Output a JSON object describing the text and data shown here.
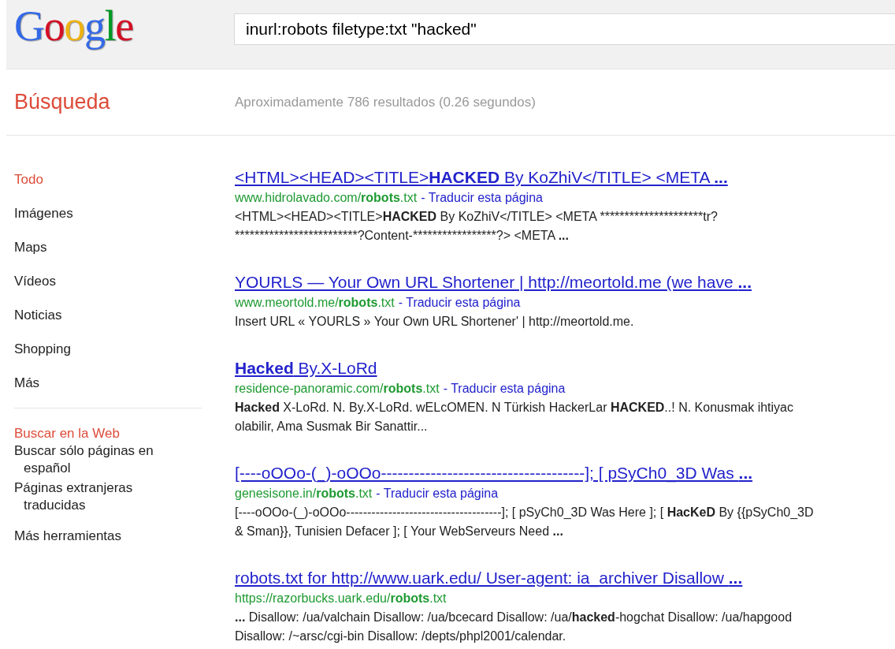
{
  "logo": "Google",
  "search": {
    "value": "inurl:robots filetype:txt \"hacked\""
  },
  "section_title": "Búsqueda",
  "result_stats": "Aproximadamente 786 resultados (0.26 segundos)",
  "sidebar": {
    "items": [
      {
        "label": "Todo",
        "selected": true
      },
      {
        "label": "Imágenes",
        "selected": false
      },
      {
        "label": "Maps",
        "selected": false
      },
      {
        "label": "Vídeos",
        "selected": false
      },
      {
        "label": "Noticias",
        "selected": false
      },
      {
        "label": "Shopping",
        "selected": false
      },
      {
        "label": "Más",
        "selected": false
      }
    ],
    "tools_heading": "Buscar en la Web",
    "tools": [
      "Buscar sólo páginas en español",
      "Páginas extranjeras traducidas"
    ],
    "more_tools": "Más herramientas"
  },
  "results": [
    {
      "title": "<HTML><HEAD><TITLE>**HACKED** By KoZhiV</TITLE> <META **...**",
      "url": "www.hidrolavado.com/**robots**.txt",
      "translate": "- Traducir esta página",
      "snippet": [
        {
          "kind": "markup",
          "text": "<HTML><HEAD><TITLE>**HACKED** By KoZhiV</TITLE> <META "
        },
        {
          "kind": "literal",
          "text": "*********************tr? *************************?Content-*****************?> <META "
        },
        {
          "kind": "markup",
          "text": "**...**"
        }
      ]
    },
    {
      "title": "YOURLS — Your Own URL Shortener | http://meortold.me (we have **...**",
      "url": "www.meortold.me/**robots**.txt",
      "translate": "- Traducir esta página",
      "snippet": "Insert URL « YOURLS » Your Own URL Shortener' | http://meortold.me."
    },
    {
      "title": "**Hacked** By.X-LoRd",
      "url": "residence-panoramic.com/**robots**.txt",
      "translate": "- Traducir esta página",
      "snippet": "**Hacked** X-LoRd. N. By.X-LoRd. wELcOMEN. N Türkish HackerLar **HACKED**..! N. Konusmak ihtiyac olabilir, Ama Susmak Bir Sanattir..."
    },
    {
      "title": "[----oOOo-(_)-oOOo-------------------------------------]; [ pSyCh0_3D Was **...**",
      "url": "genesisone.in/**robots**.txt",
      "translate": "- Traducir esta página",
      "snippet": "[----oOOo-(_)-oOOo-------------------------------------]; [ pSyCh0_3D Was Here ]; [ **HacKeD** By {{pSyCh0_3D & Sman}}, Tunisien Defacer ]; [ Your WebServeurs Need **...**"
    },
    {
      "title": "robots.txt for http://www.uark.edu/ User-agent: ia_archiver Disallow **...**",
      "url": "https://razorbucks.uark.edu/**robots**.txt",
      "snippet": "**...** Disallow: /ua/valchain Disallow: /ua/bcecard Disallow: /ua/**hacked**-hogchat Disallow: /ua/hapgood Disallow: /~arsc/cgi-bin Disallow: /depts/phpl2001/calendar."
    }
  ]
}
